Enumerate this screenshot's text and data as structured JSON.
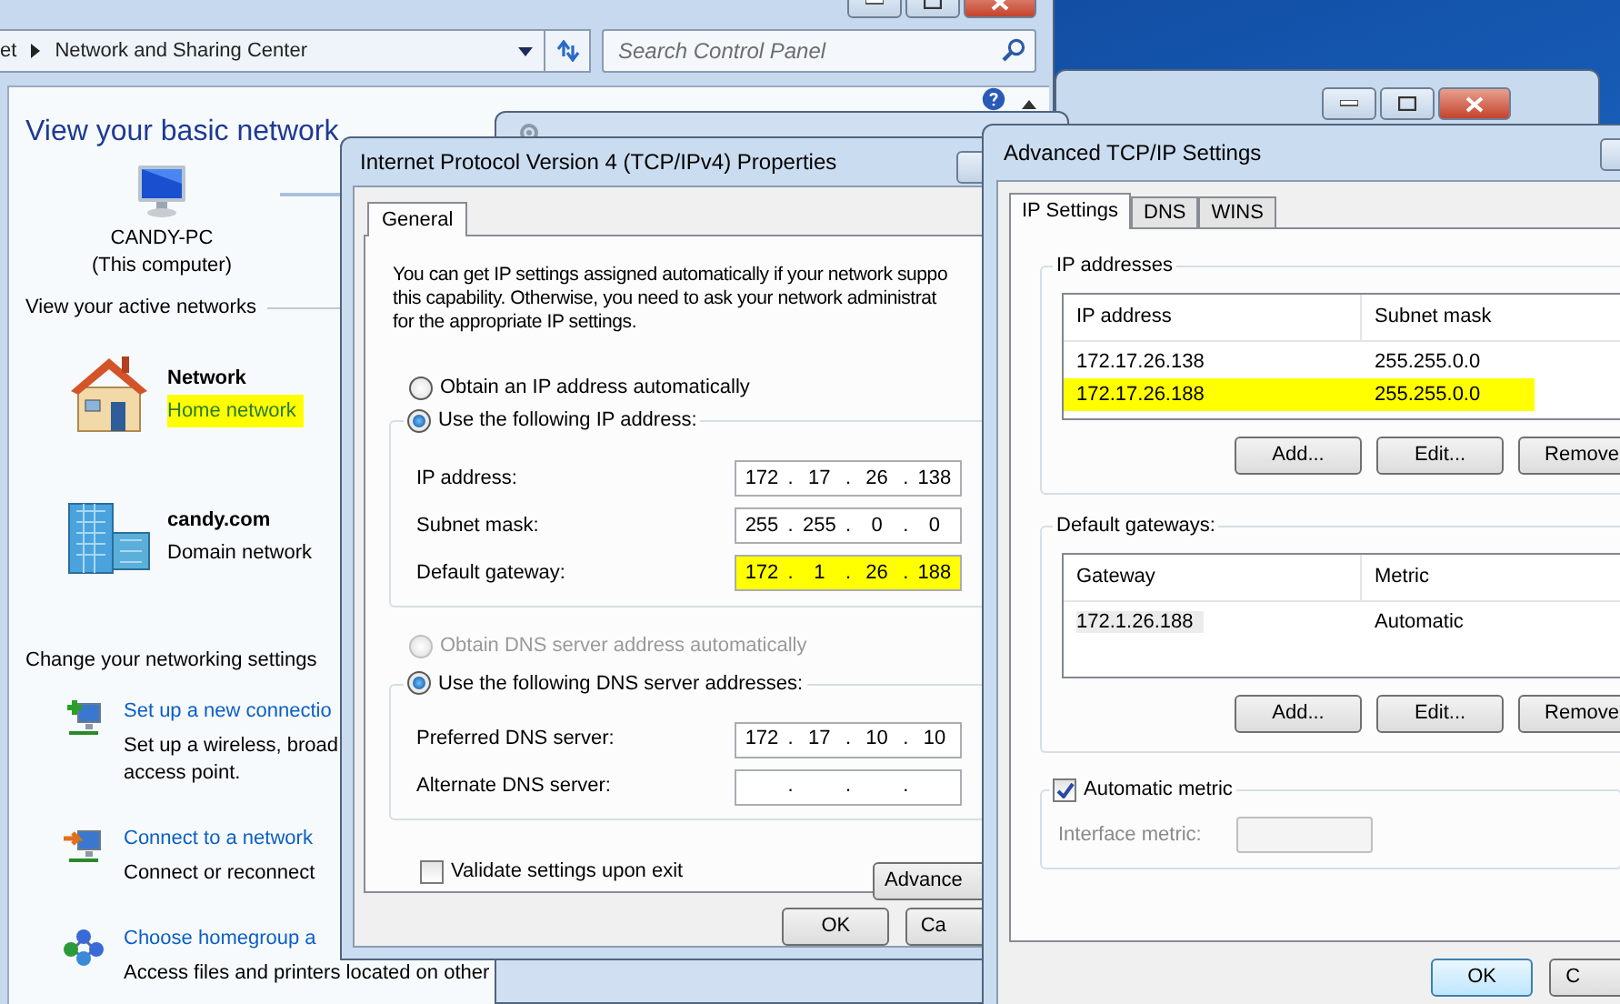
{
  "control_panel": {
    "breadcrumb": [
      "et",
      "Network and Sharing Center"
    ],
    "search": {
      "placeholder": "Search Control Panel"
    },
    "heading": "View your basic network",
    "computer": {
      "name": "CANDY-PC",
      "note": "(This computer)"
    },
    "active_label": "View your active networks",
    "networks": [
      {
        "kind": "home",
        "name": "Network",
        "type": "Home network",
        "highlighted": true
      },
      {
        "kind": "domain",
        "name": "candy.com",
        "type": "Domain network",
        "highlighted": false
      }
    ],
    "settings_label": "Change your networking settings",
    "tasks": [
      {
        "kind": "new",
        "link": "Set up a new connectio",
        "lines": [
          "Set up a wireless, broad",
          "access point."
        ]
      },
      {
        "kind": "connect",
        "link": "Connect to a network",
        "lines": [
          "Connect or reconnect"
        ]
      },
      {
        "kind": "homegroup",
        "link": "Choose homegroup a",
        "lines": [
          "Access files and printers located on other"
        ]
      }
    ]
  },
  "ipv4_dialog": {
    "title": "Internet Protocol Version 4 (TCP/IPv4) Properties",
    "tabs": [
      {
        "label": "General",
        "selected": true
      }
    ],
    "intro": [
      "You can get IP settings assigned automatically if your network suppo",
      "this capability. Otherwise, you need to ask your network administrat",
      "for the appropriate IP settings."
    ],
    "ip_options": [
      {
        "label": "Obtain an IP address automatically",
        "selected": false,
        "disabled": false
      },
      {
        "label": "Use the following IP address:",
        "selected": true,
        "disabled": false
      }
    ],
    "ip_fields": [
      {
        "label": "IP address:",
        "separator": ".",
        "octets": [
          "172",
          "17",
          "26",
          "138"
        ],
        "highlighted": false
      },
      {
        "label": "Subnet mask:",
        "separator": ".",
        "octets": [
          "255",
          "255",
          "0",
          "0"
        ],
        "highlighted": false
      },
      {
        "label": "Default gateway:",
        "separator": ".",
        "octets": [
          "172",
          "1",
          "26",
          "188"
        ],
        "highlighted": true
      }
    ],
    "dns_options": [
      {
        "label": "Obtain DNS server address automatically",
        "selected": false,
        "disabled": true
      },
      {
        "label": "Use the following DNS server addresses:",
        "selected": true,
        "disabled": false
      }
    ],
    "dns_fields": [
      {
        "label": "Preferred DNS server:",
        "separator": ".",
        "octets": [
          "172",
          "17",
          "10",
          "10"
        ],
        "highlighted": false
      },
      {
        "label": "Alternate DNS server:",
        "separator": ".",
        "highlighted": false
      }
    ],
    "validate": {
      "label": "Validate settings upon exit",
      "checked": false
    },
    "advanced_button": "Advance",
    "buttons": [
      "OK",
      "Ca"
    ]
  },
  "advanced_dialog": {
    "title": "Advanced TCP/IP Settings",
    "tabs": [
      {
        "label": "IP Settings",
        "selected": true
      },
      {
        "label": "DNS",
        "selected": false
      },
      {
        "label": "WINS",
        "selected": false
      }
    ],
    "ip_addresses": {
      "title": "IP addresses",
      "columns": [
        "IP address",
        "Subnet mask"
      ],
      "rows": [
        {
          "cells": [
            "172.17.26.138",
            "255.255.0.0"
          ],
          "highlighted": false,
          "selected": false
        },
        {
          "cells": [
            "172.17.26.188",
            "255.255.0.0"
          ],
          "highlighted": true,
          "selected": false
        }
      ],
      "buttons": [
        "Add...",
        "Edit...",
        "Remove"
      ]
    },
    "gateways": {
      "title": "Default gateways:",
      "columns": [
        "Gateway",
        "Metric"
      ],
      "rows": [
        {
          "cells": [
            "172.1.26.188",
            "Automatic"
          ],
          "highlighted": false,
          "selected": true
        }
      ],
      "buttons": [
        "Add...",
        "Edit...",
        "Remove"
      ]
    },
    "automatic_metric": {
      "label": "Automatic metric",
      "checked": true
    },
    "interface_metric": {
      "label": "Interface metric:",
      "disabled": true
    },
    "buttons": [
      "OK",
      "C"
    ]
  }
}
